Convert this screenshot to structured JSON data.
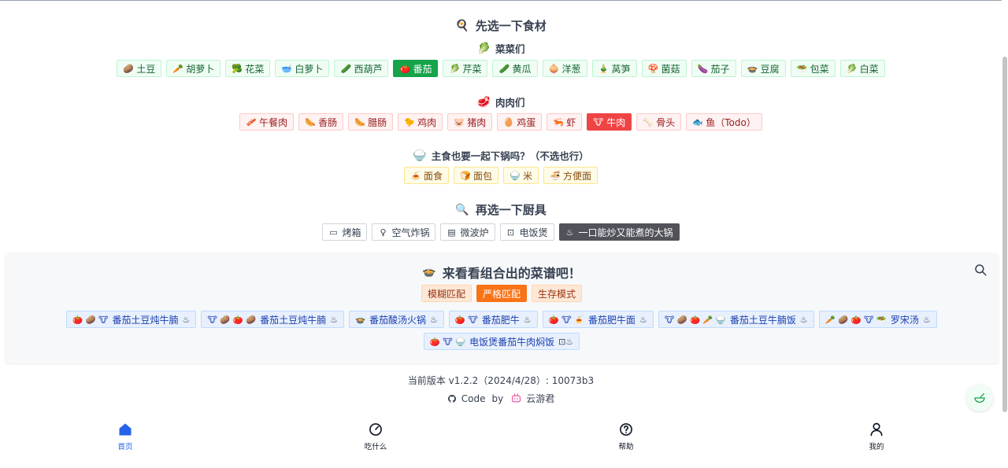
{
  "sections": {
    "ingredients_title": "先选一下食材",
    "veg_title": "菜菜们",
    "meat_title": "肉肉们",
    "staple_title": "主食也要一起下锅吗？（不选也行）",
    "tools_title": "再选一下厨具",
    "recipes_title": "来看看组合出的菜谱吧！"
  },
  "vegetables": [
    {
      "icon": "🥔",
      "label": "土豆",
      "active": false
    },
    {
      "icon": "🥕",
      "label": "胡萝卜",
      "active": false
    },
    {
      "icon": "🥦",
      "label": "花菜",
      "active": false
    },
    {
      "icon": "🥣",
      "label": "白萝卜",
      "active": false
    },
    {
      "icon": "🥒",
      "label": "西葫芦",
      "active": false
    },
    {
      "icon": "🍅",
      "label": "番茄",
      "active": true
    },
    {
      "icon": "🥬",
      "label": "芹菜",
      "active": false
    },
    {
      "icon": "🥒",
      "label": "黄瓜",
      "active": false
    },
    {
      "icon": "🧅",
      "label": "洋葱",
      "active": false
    },
    {
      "icon": "🎍",
      "label": "莴笋",
      "active": false
    },
    {
      "icon": "🍄",
      "label": "菌菇",
      "active": false
    },
    {
      "icon": "🍆",
      "label": "茄子",
      "active": false
    },
    {
      "icon": "🍲",
      "label": "豆腐",
      "active": false
    },
    {
      "icon": "🥗",
      "label": "包菜",
      "active": false
    },
    {
      "icon": "🥬",
      "label": "白菜",
      "active": false
    }
  ],
  "meats": [
    {
      "icon": "🥓",
      "label": "午餐肉",
      "active": false
    },
    {
      "icon": "🌭",
      "label": "香肠",
      "active": false
    },
    {
      "icon": "🌭",
      "label": "腊肠",
      "active": false
    },
    {
      "icon": "🐤",
      "label": "鸡肉",
      "active": false
    },
    {
      "icon": "🐷",
      "label": "猪肉",
      "active": false
    },
    {
      "icon": "🥚",
      "label": "鸡蛋",
      "active": false
    },
    {
      "icon": "🦐",
      "label": "虾",
      "active": false
    },
    {
      "icon": "🐮",
      "label": "牛肉",
      "active": true
    },
    {
      "icon": "🦴",
      "label": "骨头",
      "active": false
    },
    {
      "icon": "🐟",
      "label": "鱼（Todo）",
      "active": false
    }
  ],
  "staples": [
    {
      "icon": "🍝",
      "label": "面食"
    },
    {
      "icon": "🍞",
      "label": "面包"
    },
    {
      "icon": "🍚",
      "label": "米"
    },
    {
      "icon": "🍜",
      "label": "方便面"
    }
  ],
  "tools": [
    {
      "icon": "▭",
      "label": "烤箱",
      "active": false
    },
    {
      "icon": "♀",
      "label": "空气炸锅",
      "active": false
    },
    {
      "icon": "▤",
      "label": "微波炉",
      "active": false
    },
    {
      "icon": "⊡",
      "label": "电饭煲",
      "active": false
    },
    {
      "icon": "♨",
      "label": "一口能炒又能煮的大锅",
      "active": true
    }
  ],
  "modes": {
    "fuzzy": "模糊匹配",
    "strict": "严格匹配",
    "survival": "生存模式"
  },
  "recipes": [
    {
      "icons": "🍅 🥔 🐮",
      "name": "番茄土豆炖牛腩",
      "tool": "♨"
    },
    {
      "icons": "🐮 🥔 🍅 🥔",
      "name": "番茄土豆炖牛腩",
      "tool": "♨"
    },
    {
      "icons": "🍲",
      "name": "番茄酸汤火锅",
      "tool": "♨"
    },
    {
      "icons": "🍅 🐮",
      "name": "番茄肥牛",
      "tool": "♨"
    },
    {
      "icons": "🍅 🐮 🍝",
      "name": "番茄肥牛面",
      "tool": "♨"
    },
    {
      "icons": "🐮 🥔 🍅 🥕 🍚",
      "name": "番茄土豆牛腩饭",
      "tool": "♨"
    },
    {
      "icons": "🥕 🥔 🍅 🐮 🥗",
      "name": "罗宋汤",
      "tool": "♨"
    },
    {
      "icons": "🍅 🐮 🍚",
      "name": "电饭煲番茄牛肉焖饭",
      "tool": "⊡♨"
    }
  ],
  "footer": {
    "version": "当前版本 v1.2.2（2024/4/28）: 10073b3",
    "code": "Code",
    "by": "by",
    "author": "云游君"
  },
  "tabbar": [
    {
      "label": "首页",
      "icon": "home-icon",
      "active": true
    },
    {
      "label": "吃什么",
      "icon": "gauge-icon",
      "active": false
    },
    {
      "label": "帮助",
      "icon": "help-icon",
      "active": false
    },
    {
      "label": "我的",
      "icon": "user-icon",
      "active": false
    }
  ],
  "colors": {
    "veg_active": "#16a34a",
    "meat_active": "#ef4444",
    "tool_active": "#52525b",
    "mode_active": "#f97316",
    "tab_active": "#2563eb"
  }
}
